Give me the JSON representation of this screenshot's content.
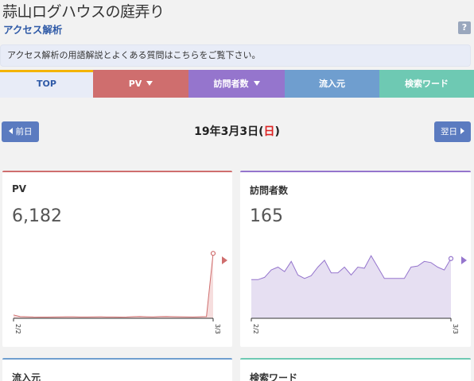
{
  "blog_title": "蒜山ログハウスの庭弄り",
  "section_title": "アクセス解析",
  "help_label": "?",
  "notice": "アクセス解析の用語解説とよくある質問はこちらをご覧下さい。",
  "tabs": [
    {
      "label": "TOP"
    },
    {
      "label": "PV"
    },
    {
      "label": "訪問者数"
    },
    {
      "label": "流入元"
    },
    {
      "label": "検索ワード"
    }
  ],
  "date_nav": {
    "prev_label": "前日",
    "next_label": "翌日",
    "date_main": "19年3月3日(",
    "date_dow": "日",
    "date_close": ")"
  },
  "colors": {
    "pv": "#cf6e6e",
    "visitors": "#9575cd",
    "sources": "#6f9ecf",
    "keywords": "#6ec9b3",
    "accent": "#f4b400"
  },
  "cards": {
    "pv": {
      "title": "PV",
      "value": "6,182",
      "x_start": "2/2",
      "x_end": "3/3"
    },
    "visitors": {
      "title": "訪問者数",
      "value": "165",
      "x_start": "2/2",
      "x_end": "3/3"
    },
    "sources": {
      "title": "流入元"
    },
    "keywords": {
      "title": "検索ワード"
    }
  },
  "chart_data": [
    {
      "type": "area",
      "series": [
        {
          "name": "PV",
          "values": [
            320,
            160,
            140,
            120,
            110,
            110,
            120,
            130,
            140,
            140,
            120,
            120,
            130,
            140,
            120,
            120,
            110,
            120,
            150,
            170,
            140,
            130,
            160,
            170,
            150,
            140,
            130,
            120,
            140,
            160,
            6182
          ]
        }
      ],
      "x_tick_labels": [
        "2/2",
        "3/3"
      ],
      "ylim": [
        0,
        6500
      ]
    },
    {
      "type": "area",
      "series": [
        {
          "name": "訪問者数",
          "values": [
            128,
            128,
            132,
            145,
            150,
            142,
            160,
            136,
            130,
            135,
            150,
            162,
            140,
            140,
            150,
            136,
            150,
            148,
            170,
            150,
            130,
            130,
            130,
            130,
            150,
            152,
            160,
            158,
            150,
            145,
            165
          ]
        }
      ],
      "x_tick_labels": [
        "2/2",
        "3/3"
      ],
      "ylim": [
        60,
        180
      ]
    }
  ]
}
